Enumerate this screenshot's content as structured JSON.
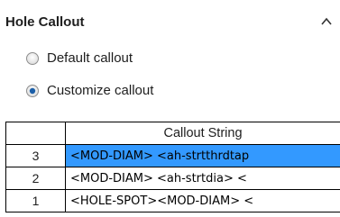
{
  "section": {
    "title": "Hole Callout"
  },
  "options": [
    {
      "label": "Default callout",
      "selected": false
    },
    {
      "label": "Customize callout",
      "selected": true
    }
  ],
  "table": {
    "header": "Callout String",
    "rows": [
      {
        "index": "3",
        "value": "<MOD-DIAM> <ah-strtthrdtap",
        "selected": true
      },
      {
        "index": "2",
        "value": "<MOD-DIAM> <ah-strtdia> <",
        "selected": false
      },
      {
        "index": "1",
        "value": "<HOLE-SPOT><MOD-DIAM> <",
        "selected": false
      }
    ]
  },
  "colors": {
    "selection": "#3399ff",
    "text": "#1e1e1e"
  },
  "icons": {
    "collapse": "chevron-up-icon"
  }
}
